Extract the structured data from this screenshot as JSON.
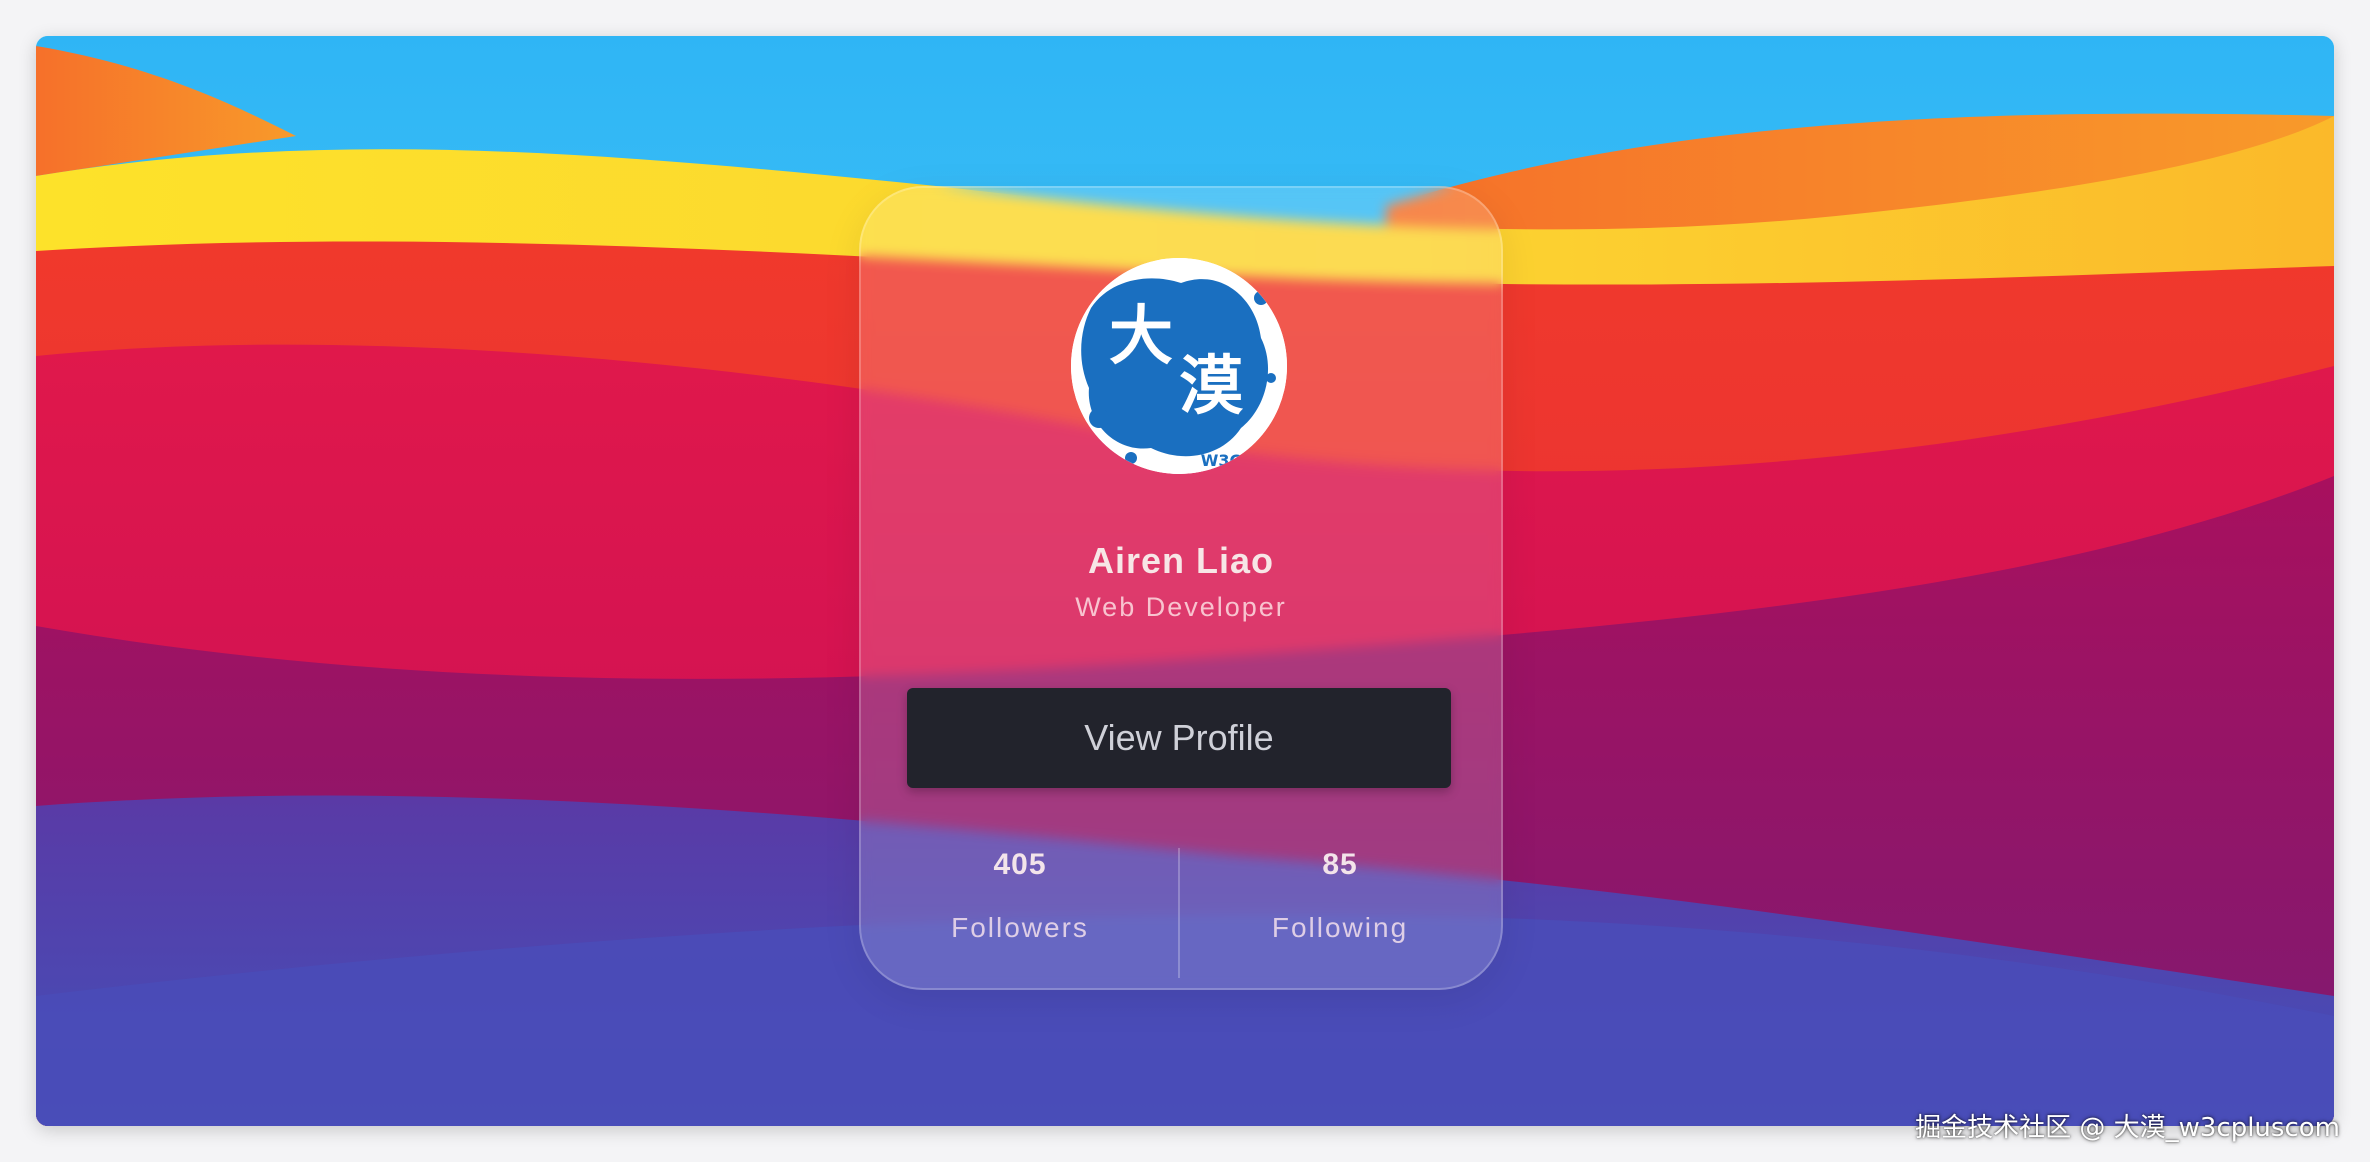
{
  "profile": {
    "name": "Airen Liao",
    "role": "Web Developer",
    "button_label": "View Profile",
    "avatar_text": "大漠",
    "avatar_small_text": "W3C"
  },
  "stats": [
    {
      "value": "405",
      "label": "Followers"
    },
    {
      "value": "85",
      "label": "Following"
    }
  ],
  "watermark": "掘金技术社区 @ 大漠_w3cpluscom",
  "colors": {
    "button_bg": "#22232c",
    "avatar_ink": "#1a6fc0",
    "sky": "#3fc8f5"
  }
}
